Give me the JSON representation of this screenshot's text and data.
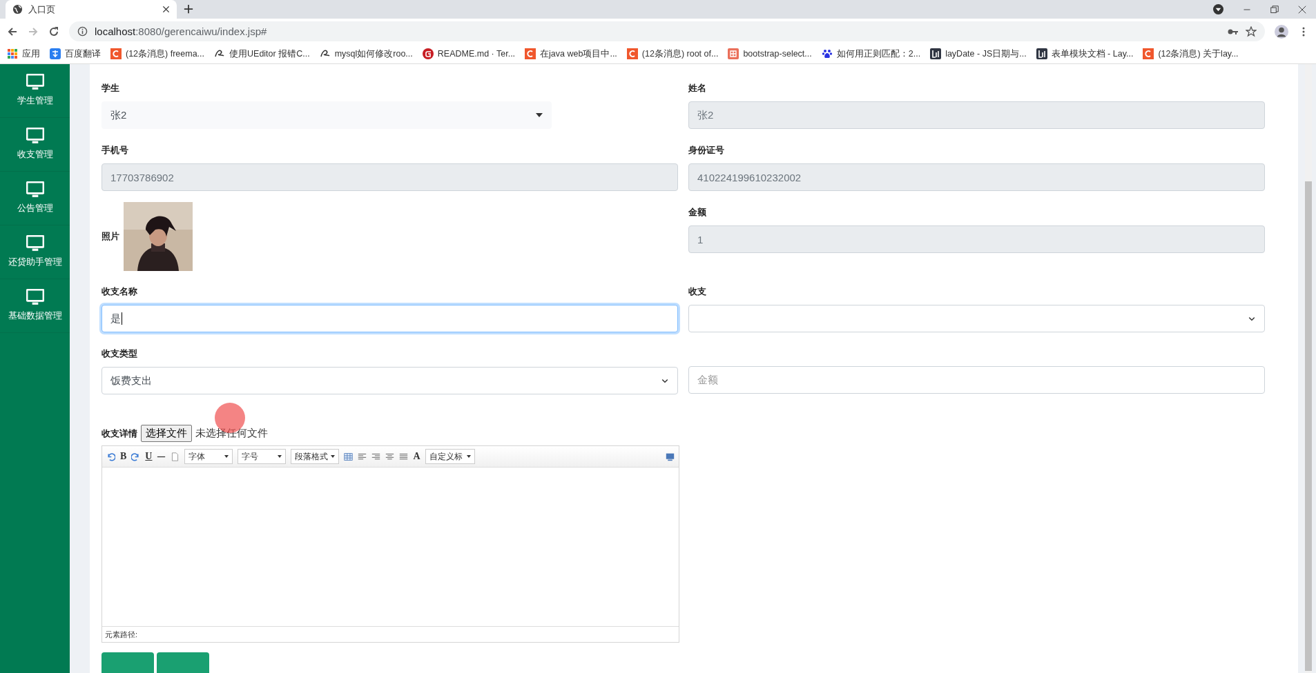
{
  "browser": {
    "tab_title": "入口页",
    "url_host": "localhost",
    "url_rest": ":8080/gerencaiwu/index.jsp#",
    "bookmarks": [
      {
        "label": "应用",
        "kind": "apps"
      },
      {
        "label": "百度翻译",
        "kind": "translate"
      },
      {
        "label": "(12条消息) freema...",
        "kind": "csdn"
      },
      {
        "label": "使用UEditor 报错C...",
        "kind": "yuque"
      },
      {
        "label": "mysql如何修改roo...",
        "kind": "yuque"
      },
      {
        "label": "README.md · Ter...",
        "kind": "gitee"
      },
      {
        "label": "在java web项目中...",
        "kind": "csdn"
      },
      {
        "label": "(12条消息) root of...",
        "kind": "csdn"
      },
      {
        "label": "bootstrap-select...",
        "kind": "jianshu"
      },
      {
        "label": "如何用正则匹配：2...",
        "kind": "baidu"
      },
      {
        "label": "layDate - JS日期与...",
        "kind": "layui"
      },
      {
        "label": "表单模块文档 - Lay...",
        "kind": "layui"
      },
      {
        "label": "(12条消息) 关于lay...",
        "kind": "csdn"
      }
    ]
  },
  "sidebar": {
    "items": [
      {
        "label": "学生管理"
      },
      {
        "label": "收支管理"
      },
      {
        "label": "公告管理"
      },
      {
        "label": "还贷助手管理"
      },
      {
        "label": "基础数据管理"
      }
    ]
  },
  "form": {
    "fields": [
      {
        "label": "学生",
        "kind": "select",
        "value": "张2"
      },
      {
        "label": "姓名",
        "kind": "readonly",
        "value": "张2"
      },
      {
        "label": "手机号",
        "kind": "readonly",
        "value": "17703786902"
      },
      {
        "label": "身份证号",
        "kind": "readonly",
        "value": "410224199610232002"
      },
      {
        "label": "照片"
      },
      {
        "label": "金额",
        "kind": "readonly",
        "value": "1"
      },
      {
        "label": "收支名称",
        "kind": "input",
        "value": "是",
        "focused": true
      },
      {
        "label": "收支",
        "kind": "native-select"
      },
      {
        "label": "收支类型",
        "kind": "native-select",
        "value": "饭费支出"
      },
      {
        "kind": "input",
        "placeholder": "金额",
        "focused": false
      }
    ],
    "detail": {
      "label": "收支详情",
      "file_button": "选择文件",
      "file_status": "未选择任何文件"
    },
    "editor": {
      "bold": "B",
      "underline": "U",
      "font": "字体",
      "size": "字号",
      "paragraph": "段落格式",
      "font_color_label": "A",
      "custom_title": "自定义标",
      "path_label": "元素路径:"
    }
  }
}
